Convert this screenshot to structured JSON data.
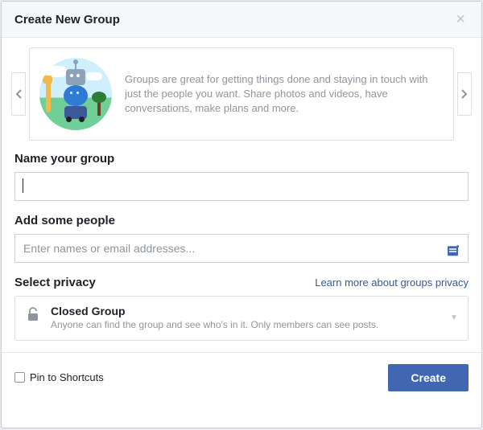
{
  "header": {
    "title": "Create New Group"
  },
  "info": {
    "description": "Groups are great for getting things done and staying in touch with just the people you want. Share photos and videos, have conversations, make plans and more."
  },
  "fields": {
    "name_label": "Name your group",
    "name_value": "",
    "people_label": "Add some people",
    "people_placeholder": "Enter names or email addresses...",
    "privacy_label": "Select privacy",
    "privacy_learn": "Learn more about groups privacy",
    "privacy_option_title": "Closed Group",
    "privacy_option_desc": "Anyone can find the group and see who's in it. Only members can see posts."
  },
  "footer": {
    "pin_label": "Pin to Shortcuts",
    "pin_checked": false,
    "create_label": "Create"
  }
}
